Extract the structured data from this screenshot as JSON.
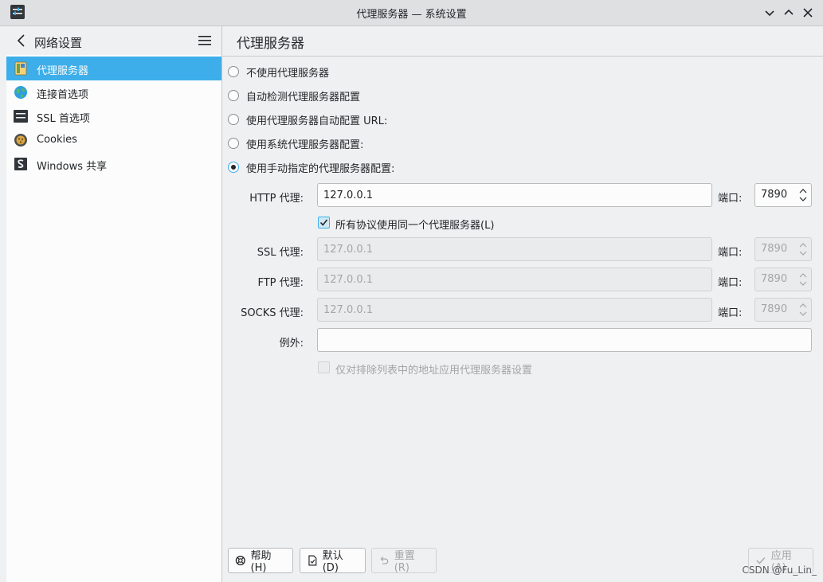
{
  "window": {
    "title": "代理服务器 — 系统设置",
    "icon": "settings-app-icon",
    "controls": [
      "minimize-icon",
      "maximize-icon",
      "close-icon"
    ]
  },
  "sidebar": {
    "title": "网络设置",
    "items": [
      {
        "label": "代理服务器",
        "icon": "proxy-icon",
        "active": true
      },
      {
        "label": "连接首选项",
        "icon": "globe-icon",
        "active": false
      },
      {
        "label": "SSL 首选项",
        "icon": "ssl-icon",
        "active": false
      },
      {
        "label": "Cookies",
        "icon": "cookie-icon",
        "active": false
      },
      {
        "label": "Windows 共享",
        "icon": "windows-share-icon",
        "active": false
      }
    ]
  },
  "main": {
    "title": "代理服务器",
    "options": [
      {
        "label": "不使用代理服务器",
        "checked": false
      },
      {
        "label": "自动检测代理服务器配置",
        "checked": false
      },
      {
        "label": "使用代理服务器自动配置 URL:",
        "checked": false
      },
      {
        "label": "使用系统代理服务器配置:",
        "checked": false
      },
      {
        "label": "使用手动指定的代理服务器配置:",
        "checked": true
      }
    ],
    "port_label": "端口:",
    "http": {
      "label": "HTTP 代理:",
      "value": "127.0.0.1",
      "port": "7890"
    },
    "same_proxy": {
      "label": "所有协议使用同一个代理服务器(L)",
      "checked": true
    },
    "ssl": {
      "label": "SSL 代理:",
      "value": "127.0.0.1",
      "port": "7890"
    },
    "ftp": {
      "label": "FTP 代理:",
      "value": "127.0.0.1",
      "port": "7890"
    },
    "socks": {
      "label": "SOCKS 代理:",
      "value": "127.0.0.1",
      "port": "7890"
    },
    "exceptions": {
      "label": "例外:",
      "value": ""
    },
    "only_exceptions": {
      "label": "仅对排除列表中的地址应用代理服务器设置",
      "checked": false
    }
  },
  "buttons": {
    "help": "帮助(H)",
    "defaults": "默认(D)",
    "reset": "重置(R)",
    "apply": "应用(A)"
  },
  "watermark": "CSDN @Fu_Lin_",
  "colors": {
    "accent": "#3daee9",
    "window_bg": "#eff0f1",
    "text": "#232629",
    "disabled_text": "#a3a5a7"
  }
}
